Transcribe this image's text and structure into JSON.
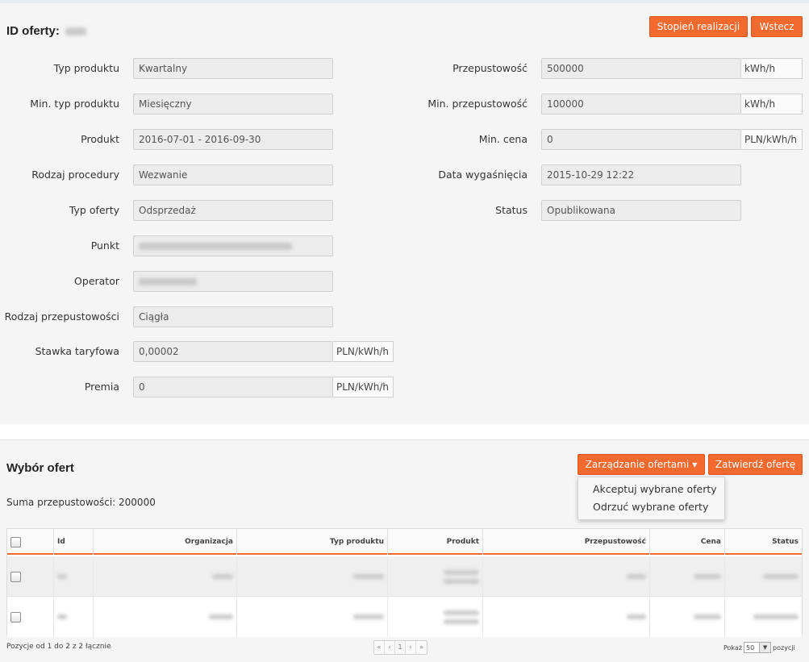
{
  "offer": {
    "title_prefix": "ID oferty:",
    "btn_progress": "Stopień realizacji",
    "btn_back": "Wstecz",
    "left_fields": [
      {
        "label": "Typ produktu",
        "value": "Kwartalny"
      },
      {
        "label": "Min. typ produktu",
        "value": "Miesięczny"
      },
      {
        "label": "Produkt",
        "value": "2016-07-01 - 2016-09-30"
      },
      {
        "label": "Rodzaj procedury",
        "value": "Wezwanie"
      },
      {
        "label": "Typ oferty",
        "value": "Odsprzedaż"
      },
      {
        "label": "Punkt",
        "value": ""
      },
      {
        "label": "Operator",
        "value": ""
      },
      {
        "label": "Rodzaj przepustowości",
        "value": "Ciągła"
      },
      {
        "label": "Stawka taryfowa",
        "value": "0,00002",
        "unit": "PLN/kWh/h"
      },
      {
        "label": "Premia",
        "value": "0",
        "unit": "PLN/kWh/h"
      }
    ],
    "right_fields": [
      {
        "label": "Przepustowość",
        "value": "500000",
        "unit": "kWh/h"
      },
      {
        "label": "Min. przepustowość",
        "value": "100000",
        "unit": "kWh/h"
      },
      {
        "label": "Min. cena",
        "value": "0",
        "unit": "PLN/kWh/h"
      },
      {
        "label": "Data wygaśnięcia",
        "value": "2015-10-29 12:22"
      },
      {
        "label": "Status",
        "value": "Opublikowana"
      }
    ]
  },
  "selection": {
    "title": "Wybór ofert",
    "btn_manage": "Zarządzanie ofertami",
    "btn_confirm": "Zatwierdź ofertę",
    "sum_text": "Suma przepustowości: 200000",
    "menu": [
      "Akceptuj wybrane oferty",
      "Odrzuć wybrane oferty"
    ],
    "columns": [
      "Id",
      "Organizacja",
      "Typ produktu",
      "Produkt",
      "Przepustowość",
      "Cena",
      "Status"
    ],
    "footer_info": "Pozycje od 1 do 2 z 2 łącznie",
    "pager": [
      "«",
      "‹",
      "1",
      "›",
      "»"
    ],
    "show_label": "Pokaż",
    "page_size": "50",
    "items_label": "pozycji"
  },
  "colors": {
    "accent": "#f26a2e"
  }
}
